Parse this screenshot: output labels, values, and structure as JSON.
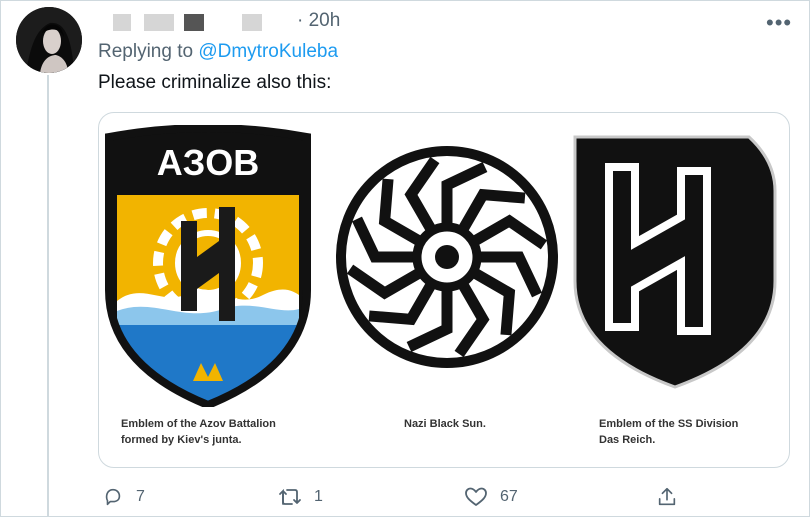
{
  "tweet": {
    "timestamp": "· 20h",
    "more_label": "•••",
    "reply_prefix": "Replying to",
    "reply_handle": "@DmytroKuleba",
    "text": "Please criminalize also this:"
  },
  "media": {
    "azov_label": "AЗOB",
    "captions": [
      {
        "line1": "Emblem of the Azov Battalion",
        "line2": "formed by Kiev's junta."
      },
      {
        "line1": "Nazi Black Sun.",
        "line2": ""
      },
      {
        "line1": "Emblem of the SS Division",
        "line2": "Das Reich."
      }
    ]
  },
  "actions": {
    "reply_count": "7",
    "retweet_count": "1",
    "like_count": "67",
    "icons": [
      "reply-icon",
      "retweet-icon",
      "like-icon",
      "share-icon"
    ]
  },
  "colors": {
    "link": "#1d9bf0",
    "muted": "#536471",
    "border": "#cfd9de",
    "azov_yellow": "#f2b400",
    "azov_blue": "#1f78c8"
  }
}
